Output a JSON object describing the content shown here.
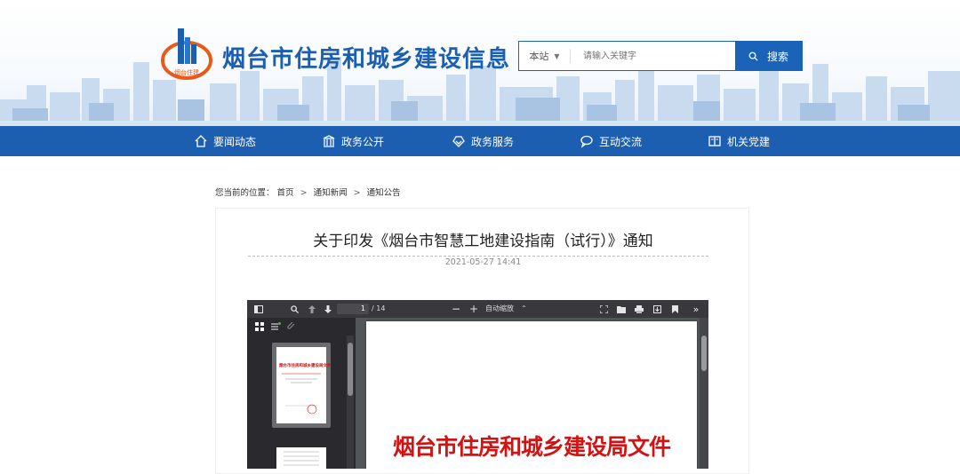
{
  "header": {
    "site_title": "烟台市住房和城乡建设信息",
    "logo_text": "烟台住建"
  },
  "search": {
    "scope": "本站",
    "placeholder": "请输入关键字",
    "button_label": "搜索"
  },
  "nav": {
    "items": [
      {
        "label": "要闻动态",
        "icon": "home-icon"
      },
      {
        "label": "政务公开",
        "icon": "government-building-icon"
      },
      {
        "label": "政务服务",
        "icon": "service-icon"
      },
      {
        "label": "互动交流",
        "icon": "chat-icon"
      },
      {
        "label": "机关党建",
        "icon": "book-icon"
      }
    ]
  },
  "breadcrumb": {
    "prefix": "您当前的位置：",
    "items": [
      "首页",
      "通知新闻",
      "通知公告"
    ],
    "separator": ">"
  },
  "article": {
    "title": "关于印发《烟台市智慧工地建设指南（试行）》通知",
    "date": "2021-05-27 14:41"
  },
  "pdf_viewer": {
    "current_page": "1",
    "page_count": "/ 14",
    "zoom_minus": "−",
    "zoom_plus": "+",
    "zoom_label": "自动缩放",
    "page_heading": "烟台市住房和城乡建设局文件",
    "thumb_heading": "烟台市住房和城乡建设局文件"
  },
  "colors": {
    "brand_blue": "#1c5fb1",
    "search_blue": "#1a63b8",
    "pdf_red": "#d41212"
  }
}
